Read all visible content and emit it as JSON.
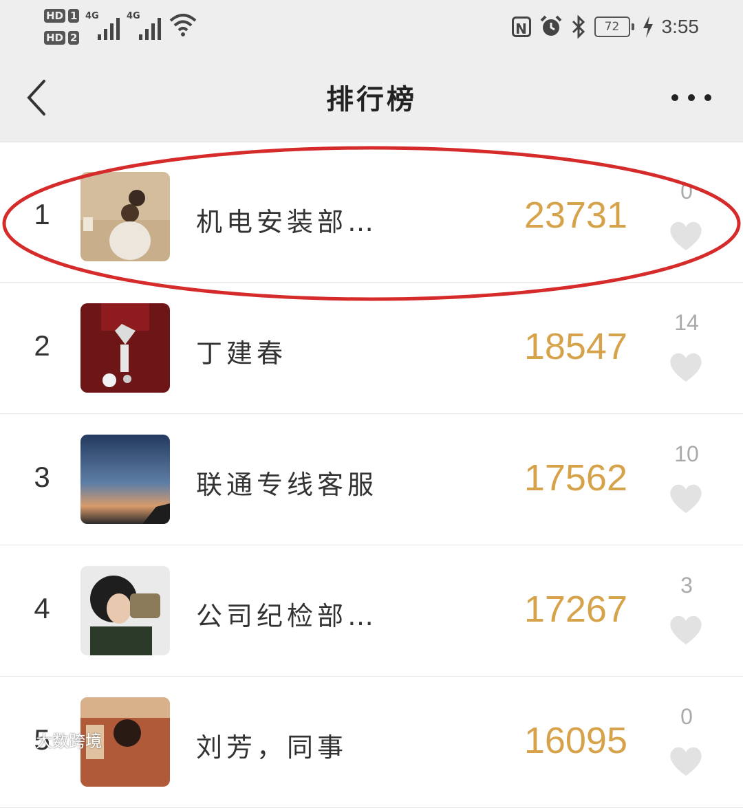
{
  "status_bar": {
    "sim1_label": "HD",
    "sim1_num": "1",
    "sim2_label": "HD",
    "sim2_num": "2",
    "network1": "4G",
    "network2": "4G",
    "nfc": "N",
    "battery": "72",
    "time": "3:55"
  },
  "nav": {
    "title": "排行榜"
  },
  "rows": [
    {
      "rank": "1",
      "name": "机电安装部…",
      "steps": "23731",
      "likes": "0"
    },
    {
      "rank": "2",
      "name": "丁建春",
      "steps": "18547",
      "likes": "14"
    },
    {
      "rank": "3",
      "name": "联通专线客服",
      "steps": "17562",
      "likes": "10"
    },
    {
      "rank": "4",
      "name": "公司纪检部…",
      "steps": "17267",
      "likes": "3"
    },
    {
      "rank": "5",
      "name": "刘芳，同事",
      "steps": "16095",
      "likes": "0"
    }
  ],
  "watermark": "大数跨境",
  "colors": {
    "steps": "#d6a24a",
    "highlight": "#d62b2b",
    "bar_bg": "#eeeeee",
    "heart": "#e2e2e2"
  }
}
